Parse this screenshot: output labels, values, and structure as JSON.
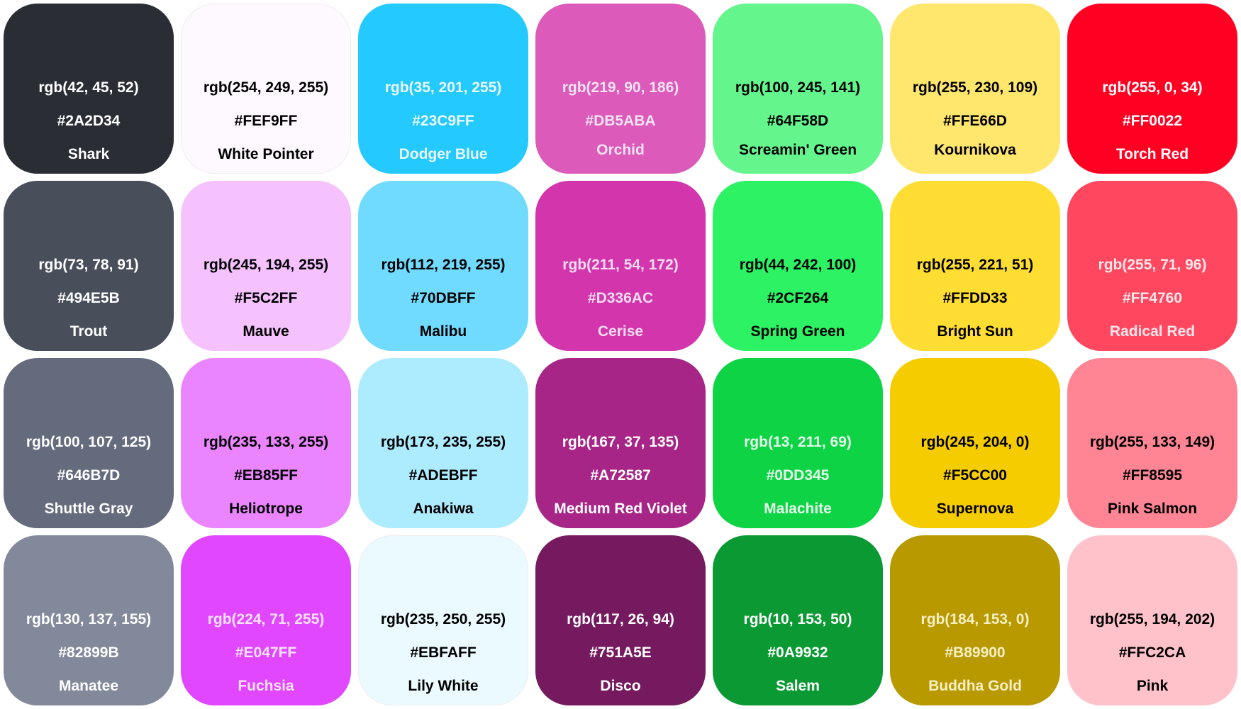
{
  "swatches": [
    {
      "rgb": "rgb(42, 45, 52)",
      "hex": "#2A2D34",
      "name": "Shark",
      "bg": "#2A2D34",
      "fg": "#FFFFFF"
    },
    {
      "rgb": "rgb(254, 249, 255)",
      "hex": "#FEF9FF",
      "name": "White Pointer",
      "bg": "#FEF9FF",
      "fg": "#000000"
    },
    {
      "rgb": "rgb(35, 201, 255)",
      "hex": "#23C9FF",
      "name": "Dodger Blue",
      "bg": "#23C9FF",
      "fg": "#EAF9FF"
    },
    {
      "rgb": "rgb(219, 90, 186)",
      "hex": "#DB5ABA",
      "name": "Orchid",
      "bg": "#DB5ABA",
      "fg": "#F6E3F2"
    },
    {
      "rgb": "rgb(100, 245, 141)",
      "hex": "#64F58D",
      "name": "Screamin' Green",
      "bg": "#64F58D",
      "fg": "#000000"
    },
    {
      "rgb": "rgb(255, 230, 109)",
      "hex": "#FFE66D",
      "name": "Kournikova",
      "bg": "#FFE66D",
      "fg": "#000000"
    },
    {
      "rgb": "rgb(255, 0, 34)",
      "hex": "#FF0022",
      "name": "Torch Red",
      "bg": "#FF0022",
      "fg": "#FFFFFF"
    },
    {
      "rgb": "rgb(73, 78, 91)",
      "hex": "#494E5B",
      "name": "Trout",
      "bg": "#494E5B",
      "fg": "#FFFFFF"
    },
    {
      "rgb": "rgb(245, 194, 255)",
      "hex": "#F5C2FF",
      "name": "Mauve",
      "bg": "#F5C2FF",
      "fg": "#000000"
    },
    {
      "rgb": "rgb(112, 219, 255)",
      "hex": "#70DBFF",
      "name": "Malibu",
      "bg": "#70DBFF",
      "fg": "#000000"
    },
    {
      "rgb": "rgb(211, 54, 172)",
      "hex": "#D336AC",
      "name": "Cerise",
      "bg": "#D336AC",
      "fg": "#F6DDF1"
    },
    {
      "rgb": "rgb(44, 242, 100)",
      "hex": "#2CF264",
      "name": "Spring Green",
      "bg": "#2CF264",
      "fg": "#000000"
    },
    {
      "rgb": "rgb(255, 221, 51)",
      "hex": "#FFDD33",
      "name": "Bright Sun",
      "bg": "#FFDD33",
      "fg": "#000000"
    },
    {
      "rgb": "rgb(255, 71, 96)",
      "hex": "#FF4760",
      "name": "Radical Red",
      "bg": "#FF4760",
      "fg": "#FFE8EB"
    },
    {
      "rgb": "rgb(100, 107, 125)",
      "hex": "#646B7D",
      "name": "Shuttle Gray",
      "bg": "#646B7D",
      "fg": "#FFFFFF"
    },
    {
      "rgb": "rgb(235, 133, 255)",
      "hex": "#EB85FF",
      "name": "Heliotrope",
      "bg": "#EB85FF",
      "fg": "#000000"
    },
    {
      "rgb": "rgb(173, 235, 255)",
      "hex": "#ADEBFF",
      "name": "Anakiwa",
      "bg": "#ADEBFF",
      "fg": "#000000"
    },
    {
      "rgb": "rgb(167, 37, 135)",
      "hex": "#A72587",
      "name": "Medium Red Violet",
      "bg": "#A72587",
      "fg": "#FFFFFF"
    },
    {
      "rgb": "rgb(13, 211, 69)",
      "hex": "#0DD345",
      "name": "Malachite",
      "bg": "#0DD345",
      "fg": "#E6FBEC"
    },
    {
      "rgb": "rgb(245, 204, 0)",
      "hex": "#F5CC00",
      "name": "Supernova",
      "bg": "#F5CC00",
      "fg": "#000000"
    },
    {
      "rgb": "rgb(255, 133, 149)",
      "hex": "#FF8595",
      "name": "Pink Salmon",
      "bg": "#FF8595",
      "fg": "#000000"
    },
    {
      "rgb": "rgb(130, 137, 155)",
      "hex": "#82899B",
      "name": "Manatee",
      "bg": "#82899B",
      "fg": "#FFFFFF"
    },
    {
      "rgb": "rgb(224, 71, 255)",
      "hex": "#E047FF",
      "name": "Fuchsia",
      "bg": "#E047FF",
      "fg": "#FAE3FF"
    },
    {
      "rgb": "rgb(235, 250, 255)",
      "hex": "#EBFAFF",
      "name": "Lily White",
      "bg": "#EBFAFF",
      "fg": "#000000"
    },
    {
      "rgb": "rgb(117, 26, 94)",
      "hex": "#751A5E",
      "name": "Disco",
      "bg": "#751A5E",
      "fg": "#FFFFFF"
    },
    {
      "rgb": "rgb(10, 153, 50)",
      "hex": "#0A9932",
      "name": "Salem",
      "bg": "#0A9932",
      "fg": "#FFFFFF"
    },
    {
      "rgb": "rgb(184, 153, 0)",
      "hex": "#B89900",
      "name": "Buddha Gold",
      "bg": "#B89900",
      "fg": "#F6EFC6"
    },
    {
      "rgb": "rgb(255, 194, 202)",
      "hex": "#FFC2CA",
      "name": "Pink",
      "bg": "#FFC2CA",
      "fg": "#000000"
    }
  ]
}
